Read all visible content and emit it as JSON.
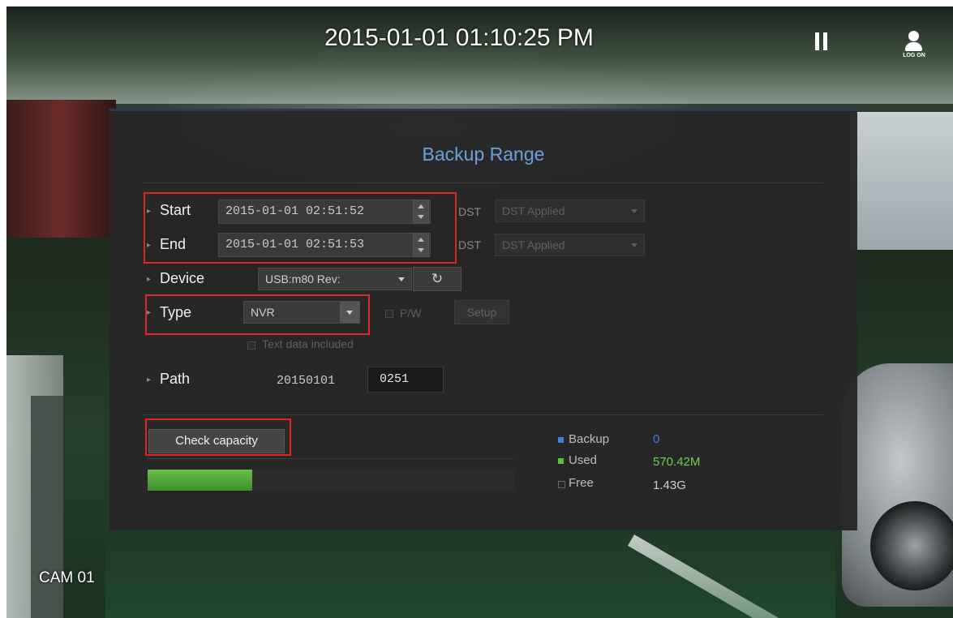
{
  "osd": {
    "datetime": "2015-01-01 01:10:25 PM",
    "logon_label": "LOG ON",
    "camera_label": "CAM 01"
  },
  "dialog": {
    "title": "Backup Range",
    "start": {
      "label": "Start",
      "value": "2015-01-01 02:51:52",
      "dst_label": "DST",
      "dst_value": "DST Applied"
    },
    "end": {
      "label": "End",
      "value": "2015-01-01 02:51:53",
      "dst_label": "DST",
      "dst_value": "DST Applied"
    },
    "device": {
      "label": "Device",
      "value": "USB:m80 Rev:",
      "refresh_icon": "refresh-icon"
    },
    "type": {
      "label": "Type",
      "value": "NVR",
      "pw_label": "P/W",
      "setup_label": "Setup",
      "text_data_label": "Text data included"
    },
    "path": {
      "label": "Path",
      "date": "20150101",
      "value": "0251"
    },
    "capacity": {
      "button_label": "Check capacity",
      "used_fraction": 0.285,
      "legend": [
        {
          "label": "Backup",
          "value": "0",
          "color": "#3f7fe0",
          "value_color": "#3f7fe0"
        },
        {
          "label": "Used",
          "value": "570.42M",
          "color": "#5cc23a",
          "value_color": "#6fd04a"
        },
        {
          "label": "Free",
          "value": "1.43G",
          "color": "#555555",
          "value_color": "#d0d0d0"
        }
      ]
    }
  },
  "colors": {
    "title": "#6aa1dc",
    "highlight": "#e02424",
    "capacity_fill": "#5cc23a"
  }
}
